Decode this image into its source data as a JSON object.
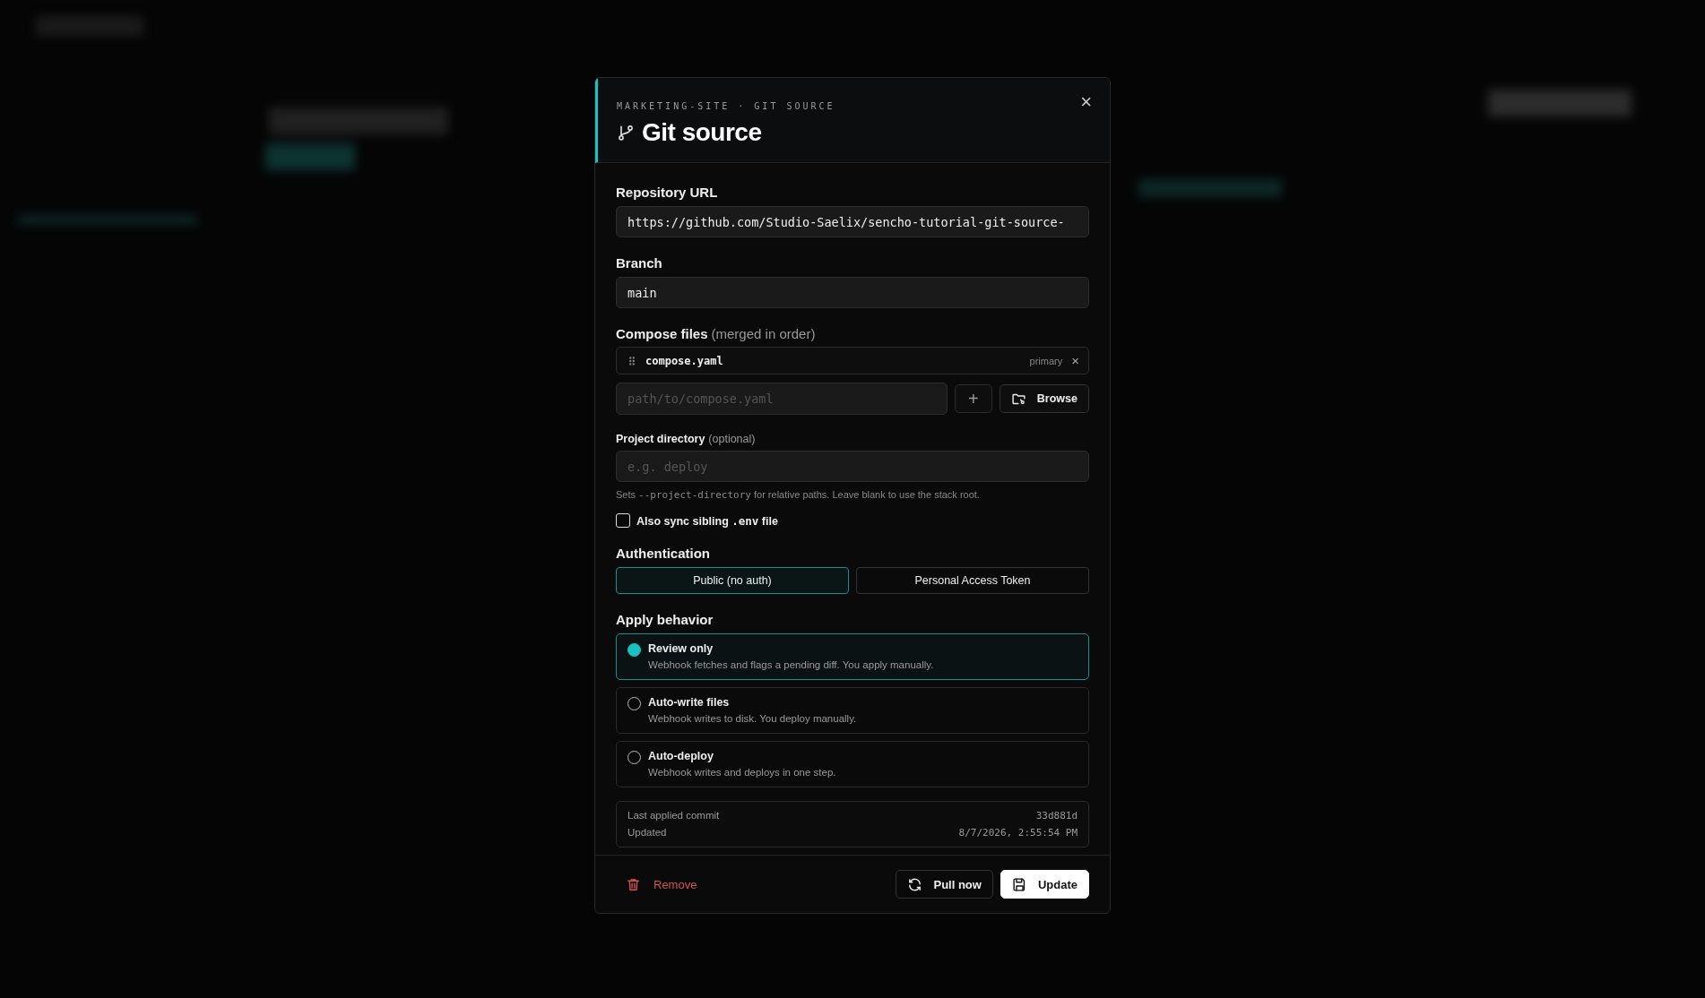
{
  "dialog": {
    "eyebrow": "MARKETING-SITE · GIT SOURCE",
    "title": "Git source",
    "close": "×"
  },
  "repository": {
    "label": "Repository URL",
    "value": "https://github.com/Studio-Saelix/sencho-tutorial-git-source-"
  },
  "branch": {
    "label": "Branch",
    "value": "main"
  },
  "compose": {
    "label": "Compose files",
    "note": "(merged in order)",
    "files": [
      {
        "name": "compose.yaml",
        "tag": "primary",
        "remove": "×"
      }
    ],
    "placeholder": "path/to/compose.yaml",
    "add": "+",
    "browse": "Browse"
  },
  "project_directory": {
    "label": "Project directory",
    "note": "(optional)",
    "placeholder": "e.g. deploy",
    "hint": {
      "before": "Sets",
      "code": "--project-directory",
      "after": "for relative paths. Leave blank to use the stack root."
    }
  },
  "sync_env": {
    "before": "Also sync sibling",
    "code": ".env",
    "after": "file",
    "checked": false
  },
  "authentication": {
    "label": "Authentication",
    "options": [
      {
        "label": "Public (no auth)",
        "selected": true
      },
      {
        "label": "Personal Access Token",
        "selected": false
      }
    ]
  },
  "apply_behavior": {
    "label": "Apply behavior",
    "options": [
      {
        "title": "Review only",
        "description": "Webhook fetches and flags a pending diff. You apply manually.",
        "selected": true
      },
      {
        "title": "Auto-write files",
        "description": "Webhook writes to disk. You deploy manually.",
        "selected": false
      },
      {
        "title": "Auto-deploy",
        "description": "Webhook writes and deploys in one step.",
        "selected": false
      }
    ]
  },
  "info": [
    {
      "label": "Last applied commit",
      "value": "33d881d"
    },
    {
      "label": "Updated",
      "value": "8/7/2026, 2:55:54 PM"
    }
  ],
  "footer": {
    "remove": "Remove",
    "pull": "Pull now",
    "update": "Update"
  }
}
